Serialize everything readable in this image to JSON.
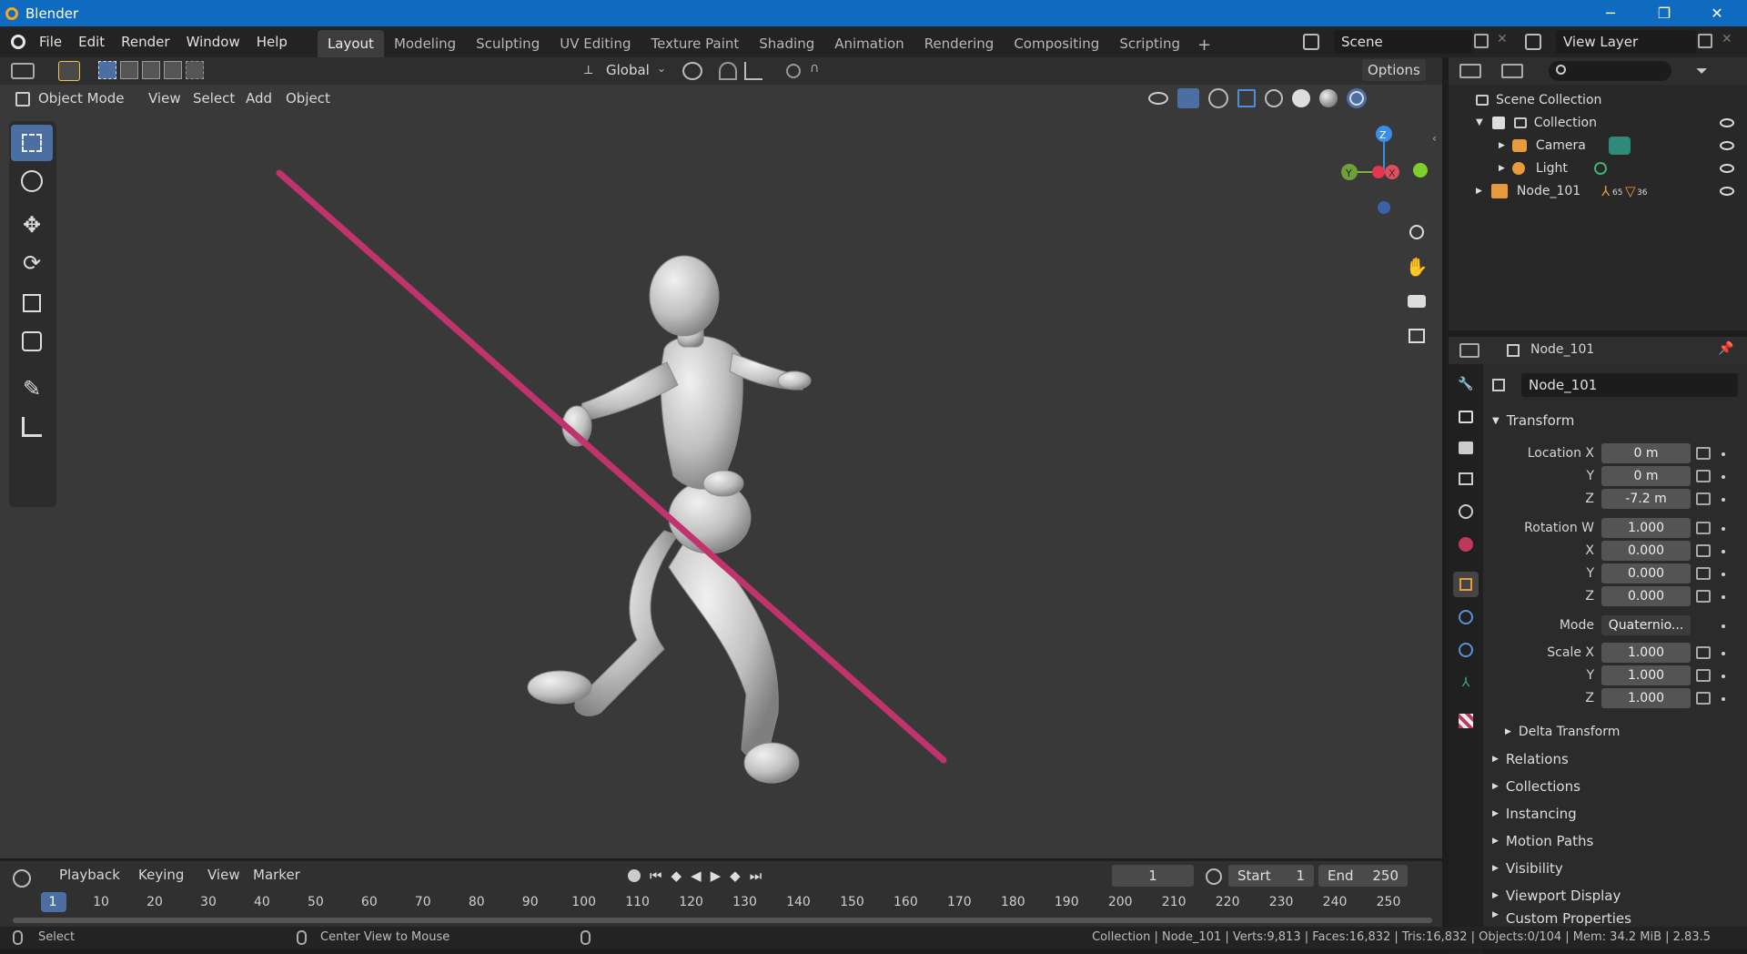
{
  "window": {
    "title": "Blender",
    "minimize": "─",
    "restore": "❐",
    "close": "✕"
  },
  "menus": [
    "File",
    "Edit",
    "Render",
    "Window",
    "Help"
  ],
  "workspaces": [
    "Layout",
    "Modeling",
    "Sculpting",
    "UV Editing",
    "Texture Paint",
    "Shading",
    "Animation",
    "Rendering",
    "Compositing",
    "Scripting"
  ],
  "add_workspace": "+",
  "scene": "Scene",
  "view_layer": "View Layer",
  "viewport": {
    "orientation": "Global",
    "options": "Options",
    "mode": "Object Mode",
    "menus": [
      "View",
      "Select",
      "Add",
      "Object"
    ],
    "gizmo": {
      "z": "Z",
      "y": "Y",
      "x": "X"
    }
  },
  "outliner": {
    "root": "Scene Collection",
    "items": [
      {
        "label": "Collection"
      },
      {
        "label": "Camera"
      },
      {
        "label": "Light"
      },
      {
        "label": "Node_101",
        "badge1": "65",
        "badge2": "36"
      }
    ]
  },
  "properties": {
    "header_object": "Node_101",
    "object_name": "Node_101",
    "transform_title": "Transform",
    "location_label": "Location X",
    "y_label": "Y",
    "z_label": "Z",
    "x_label": "X",
    "location": {
      "x": "0 m",
      "y": "0 m",
      "z": "-7.2 m"
    },
    "rotation_label": "Rotation W",
    "rotation": {
      "w": "1.000",
      "x": "0.000",
      "y": "0.000",
      "z": "0.000"
    },
    "mode_label": "Mode",
    "mode_value": "Quaternio...",
    "scale_label": "Scale X",
    "scale": {
      "x": "1.000",
      "y": "1.000",
      "z": "1.000"
    },
    "delta_transform": "Delta Transform",
    "panels": [
      "Relations",
      "Collections",
      "Instancing",
      "Motion Paths",
      "Visibility",
      "Viewport Display",
      "Custom Properties"
    ]
  },
  "timeline": {
    "menus": [
      "Playback",
      "Keying",
      "View",
      "Marker"
    ],
    "current_frame": "1",
    "start_label": "Start",
    "start": "1",
    "end_label": "End",
    "end": "250",
    "ticks": [
      "1",
      "10",
      "20",
      "30",
      "40",
      "50",
      "60",
      "70",
      "80",
      "90",
      "100",
      "110",
      "120",
      "130",
      "140",
      "150",
      "160",
      "170",
      "180",
      "190",
      "200",
      "210",
      "220",
      "230",
      "240",
      "250"
    ]
  },
  "statusbar": {
    "select": "Select",
    "center_view": "Center View to Mouse",
    "stats": "Collection | Node_101 | Verts:9,813 | Faces:16,832 | Tris:16,832 | Objects:0/104 | Mem: 34.2 MiB | 2.83.5"
  },
  "colors": {
    "accent": "#0e6bc0",
    "pole": "#c0336d",
    "active_tool": "#4c6fa3"
  }
}
